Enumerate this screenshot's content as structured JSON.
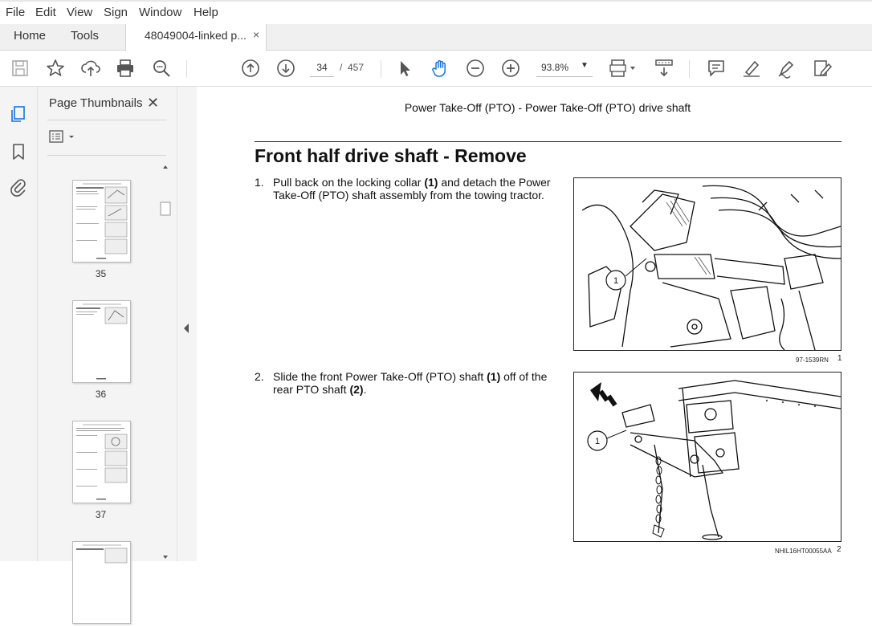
{
  "menu": [
    "File",
    "Edit",
    "View",
    "Sign",
    "Window",
    "Help"
  ],
  "tabs": {
    "home": "Home",
    "tools": "Tools",
    "document": "48049004-linked p...",
    "close_glyph": "×"
  },
  "toolbar": {
    "current_page": "34",
    "page_separator": "/",
    "total_pages": "457",
    "zoom": "93.8%",
    "icons": [
      "save-icon",
      "star-icon",
      "upload-icon",
      "print-icon",
      "find-icon",
      "page-up-icon",
      "page-down-icon",
      "select-pointer-icon",
      "hand-tool-icon",
      "zoom-out-icon",
      "zoom-in-icon",
      "page-fit-icon",
      "scroll-mode-icon",
      "comment-icon",
      "highlight-icon",
      "sign-icon",
      "edit-pdf-icon"
    ]
  },
  "sidebar": {
    "title": "Page Thumbnails",
    "close_glyph": "✕",
    "thumbnails": [
      {
        "label": "35"
      },
      {
        "label": "36"
      },
      {
        "label": "37"
      }
    ]
  },
  "document": {
    "running_head": "Power Take-Off (PTO) - Power Take-Off (PTO) drive shaft",
    "section_title": "Front half drive shaft - Remove",
    "steps": [
      {
        "number": "1.",
        "text_html_parts": [
          "Pull back on the locking collar ",
          "(1)",
          " and detach the Power Take-Off (PTO) shaft assembly from the towing tractor."
        ],
        "figure": {
          "callout": "1",
          "code": "97-1539RN",
          "number": "1"
        }
      },
      {
        "number": "2.",
        "text_html_parts": [
          "Slide the front Power Take-Off (PTO) shaft ",
          "(1)",
          " off of the rear PTO shaft ",
          "(2)",
          "."
        ],
        "figure": {
          "callout": "1",
          "code": "NHIL16HT00055AA",
          "number": "2"
        }
      }
    ]
  }
}
